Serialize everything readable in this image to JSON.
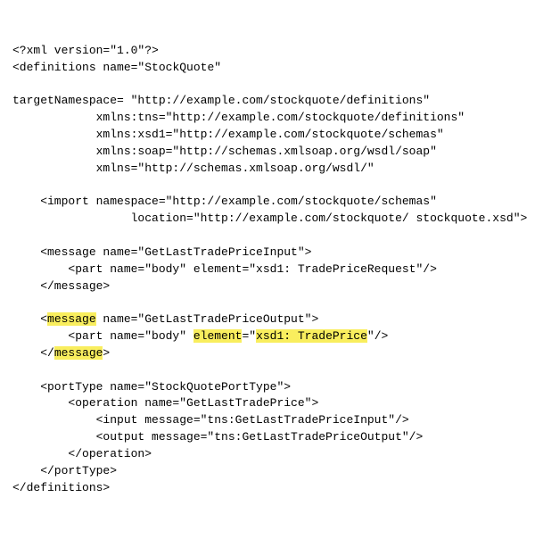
{
  "lines": {
    "l01": "<?xml version=\"1.0\"?>",
    "l02a": "<definitions name=\"",
    "l02b": "StockQuote",
    "l02c": "\"",
    "l03": "",
    "l04": "targetNamespace= \"http://example.com/stockquote/definitions\"",
    "l05": "            xmlns:tns=\"http://example.com/stockquote/definitions\"",
    "l06": "            xmlns:xsd1=\"http://example.com/stockquote/schemas\"",
    "l07": "            xmlns:soap=\"http://schemas.xmlsoap.org/wsdl/soap\"",
    "l08": "            xmlns=\"http://schemas.xmlsoap.org/wsdl/\"",
    "l09": "",
    "l10": "    <import namespace=\"http://example.com/stockquote/schemas\"",
    "l11": "                 location=\"http://example.com/stockquote/ stockquote.xsd\">",
    "l12": "",
    "l13": "    <message name=\"GetLastTradePriceInput\">",
    "l14": "        <part name=\"body\" element=\"xsd1: TradePriceRequest\"/>",
    "l15": "    </message>",
    "l16": "",
    "l17a": "    <",
    "l17b": "message",
    "l17c": " name=\"GetLastTradePriceOutput\">",
    "l18a": "        <part name=\"body\" ",
    "l18b": "element",
    "l18c": "=\"",
    "l18d": "xsd1: TradePrice",
    "l18e": "\"/>",
    "l19a": "    </",
    "l19b": "message",
    "l19c": ">",
    "l20": "",
    "l21": "    <portType name=\"StockQuotePortType\">",
    "l22": "        <operation name=\"GetLastTradePrice\">",
    "l23": "            <input message=\"tns:GetLastTradePriceInput\"/>",
    "l24": "            <output message=\"tns:GetLastTradePriceOutput\"/>",
    "l25": "        </operation>",
    "l26": "    </portType>",
    "l27": "</definitions>"
  }
}
